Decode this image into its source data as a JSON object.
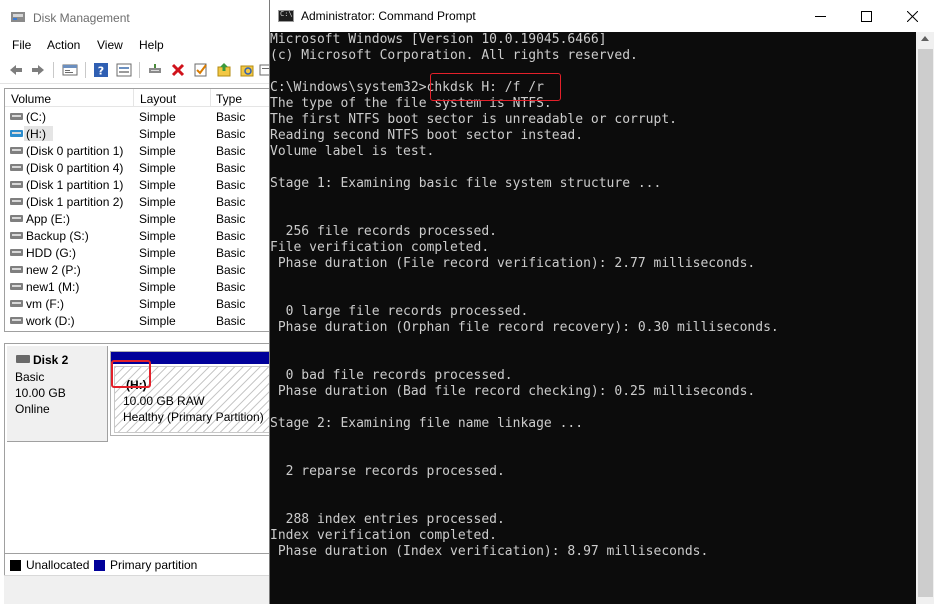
{
  "disk_management": {
    "title": "Disk Management",
    "menu": [
      "File",
      "Action",
      "View",
      "Help"
    ],
    "toolbar_icons": [
      "back-icon",
      "forward-icon",
      "properties-icon",
      "help-icon",
      "view-icon",
      "connect-icon",
      "delete-icon",
      "check-icon",
      "open-icon",
      "explore-icon",
      "more-icon"
    ],
    "columns": [
      "Volume",
      "Layout",
      "Type"
    ],
    "volumes": [
      {
        "name": "(C:)",
        "layout": "Simple",
        "type": "Basic"
      },
      {
        "name": "(H:)",
        "layout": "Simple",
        "type": "Basic"
      },
      {
        "name": "(Disk 0 partition 1)",
        "layout": "Simple",
        "type": "Basic"
      },
      {
        "name": "(Disk 0 partition 4)",
        "layout": "Simple",
        "type": "Basic"
      },
      {
        "name": "(Disk 1 partition 1)",
        "layout": "Simple",
        "type": "Basic"
      },
      {
        "name": "(Disk 1 partition 2)",
        "layout": "Simple",
        "type": "Basic"
      },
      {
        "name": "App (E:)",
        "layout": "Simple",
        "type": "Basic"
      },
      {
        "name": "Backup (S:)",
        "layout": "Simple",
        "type": "Basic"
      },
      {
        "name": "HDD (G:)",
        "layout": "Simple",
        "type": "Basic"
      },
      {
        "name": "new 2 (P:)",
        "layout": "Simple",
        "type": "Basic"
      },
      {
        "name": "new1 (M:)",
        "layout": "Simple",
        "type": "Basic"
      },
      {
        "name": "vm (F:)",
        "layout": "Simple",
        "type": "Basic"
      },
      {
        "name": "work (D:)",
        "layout": "Simple",
        "type": "Basic"
      }
    ],
    "disk": {
      "name": "Disk 2",
      "kind": "Basic",
      "size": "10.00 GB",
      "status": "Online",
      "partition": {
        "name": "(H:)",
        "size": "10.00 GB RAW",
        "health": "Healthy (Primary Partition)"
      }
    },
    "legend": [
      {
        "label": "Unallocated",
        "color": "#000000"
      },
      {
        "label": "Primary partition",
        "color": "#00009a"
      }
    ]
  },
  "cmd": {
    "title": "Administrator: Command Prompt",
    "lines": [
      "Microsoft Windows [Version 10.0.19045.6466]",
      "(c) Microsoft Corporation. All rights reserved.",
      "",
      "C:\\Windows\\system32>chkdsk H: /f /r",
      "The type of the file system is NTFS.",
      "The first NTFS boot sector is unreadable or corrupt.",
      "Reading second NTFS boot sector instead.",
      "Volume label is test.",
      "",
      "Stage 1: Examining basic file system structure ...",
      "",
      "",
      "  256 file records processed.",
      "File verification completed.",
      " Phase duration (File record verification): 2.77 milliseconds.",
      "",
      "",
      "  0 large file records processed.",
      " Phase duration (Orphan file record recovery): 0.30 milliseconds.",
      "",
      "",
      "  0 bad file records processed.",
      " Phase duration (Bad file record checking): 0.25 milliseconds.",
      "",
      "Stage 2: Examining file name linkage ...",
      "",
      "",
      "  2 reparse records processed.",
      "",
      "",
      "  288 index entries processed.",
      "Index verification completed.",
      " Phase duration (Index verification): 8.97 milliseconds."
    ],
    "text_color": "#cccccc",
    "background": "#0c0c0c"
  },
  "highlight_color": "#e3202a"
}
